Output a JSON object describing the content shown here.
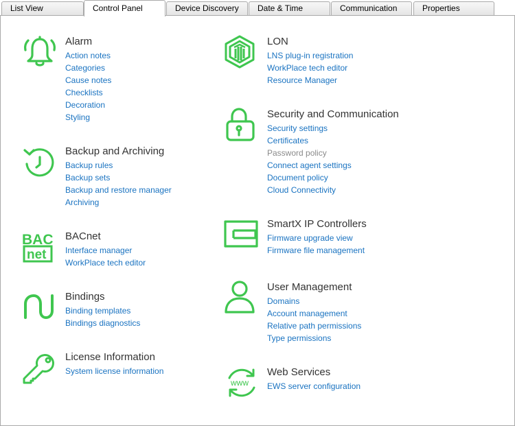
{
  "tabs": [
    {
      "label": "List View"
    },
    {
      "label": "Control Panel"
    },
    {
      "label": "Device Discovery"
    },
    {
      "label": "Date & Time"
    },
    {
      "label": "Communication"
    },
    {
      "label": "Properties"
    }
  ],
  "active_tab": "Control Panel",
  "colors": {
    "icon_green": "#3fc64f",
    "link_blue": "#1a73c1",
    "disabled_gray": "#8a8a8a",
    "title_text": "#333333"
  },
  "sections": {
    "alarm": {
      "title": "Alarm",
      "icon": "bell-icon",
      "links": [
        "Action notes",
        "Categories",
        "Cause notes",
        "Checklists",
        "Decoration",
        "Styling"
      ]
    },
    "backup": {
      "title": "Backup and Archiving",
      "icon": "clock-restore-icon",
      "links": [
        "Backup rules",
        "Backup sets",
        "Backup and restore manager",
        "Archiving"
      ]
    },
    "bacnet": {
      "title": "BACnet",
      "icon": "bacnet-logo-icon",
      "icon_text_top": "BAC",
      "icon_text_bottom": "net",
      "links": [
        "Interface manager",
        "WorkPlace tech editor"
      ]
    },
    "bindings": {
      "title": "Bindings",
      "icon": "bindings-icon",
      "links": [
        "Binding templates",
        "Bindings diagnostics"
      ]
    },
    "license": {
      "title": "License Information",
      "icon": "key-icon",
      "links": [
        "System license information"
      ]
    },
    "lon": {
      "title": "LON",
      "icon": "lon-hexagon-icon",
      "links": [
        "LNS plug-in registration",
        "WorkPlace tech editor",
        "Resource Manager"
      ]
    },
    "security": {
      "title": "Security and Communication",
      "icon": "padlock-icon",
      "links": [
        "Security settings",
        "Certificates",
        "Password policy",
        "Connect agent settings",
        "Document policy",
        "Cloud Connectivity"
      ],
      "disabled_links": [
        "Password policy"
      ]
    },
    "smartx": {
      "title": "SmartX IP Controllers",
      "icon": "controller-icon",
      "links": [
        "Firmware upgrade view",
        "Firmware file management"
      ]
    },
    "users": {
      "title": "User Management",
      "icon": "user-icon",
      "links": [
        "Domains",
        "Account management",
        "Relative path permissions",
        "Type permissions"
      ]
    },
    "web": {
      "title": "Web Services",
      "icon": "www-sync-icon",
      "icon_text": "www",
      "links": [
        "EWS server configuration"
      ]
    }
  }
}
